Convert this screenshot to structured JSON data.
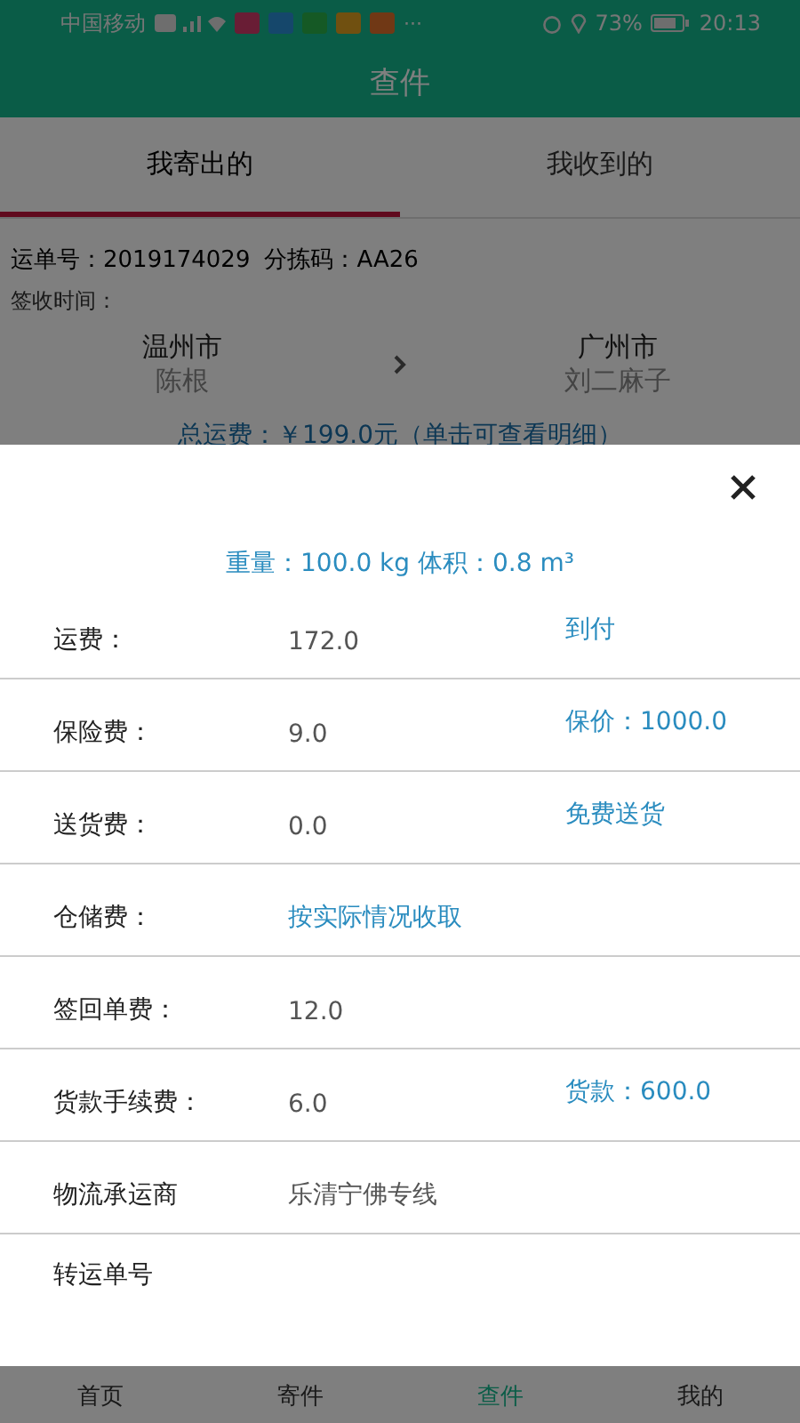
{
  "status_bar": {
    "carrier": "中国移动",
    "more": "···",
    "battery": "73%",
    "time": "20:13"
  },
  "title": "查件",
  "tabs": [
    {
      "label": "我寄出的",
      "selected": true
    },
    {
      "label": "我收到的",
      "selected": false
    }
  ],
  "shipment": {
    "waybill": "运单号：2019174029",
    "sort_code": "分拣码：AA26",
    "sign_time": "签收时间：",
    "from_city": "温州市",
    "from_name": "陈根",
    "to_city": "广州市",
    "to_name": "刘二麻子",
    "total": "总运费：￥199.0元（单击可查看明细）"
  },
  "fee_sheet": {
    "summary": "重量：100.0 kg 体积：0.8 m³",
    "rows": [
      {
        "label": "运费：",
        "value": "172.0",
        "kind": "plain",
        "extra": "到付"
      },
      {
        "label": "保险费：",
        "value": "9.0",
        "kind": "plain",
        "extra": "保价：1000.0"
      },
      {
        "label": "送货费：",
        "value": "0.0",
        "kind": "plain",
        "extra": "免费送货"
      },
      {
        "label": "仓储费：",
        "value": "按实际情况收取",
        "kind": "note"
      },
      {
        "label": "签回单费：",
        "value": "12.0",
        "kind": "plain"
      },
      {
        "label": "货款手续费：",
        "value": "6.0",
        "kind": "plain",
        "extra": "货款：600.0"
      },
      {
        "label": "物流承运商",
        "value": "乐清宁佛专线",
        "kind": "plain"
      },
      {
        "label": "转运单号",
        "kind": "plain"
      }
    ]
  },
  "bottom_nav": [
    {
      "label": "首页",
      "selected": false
    },
    {
      "label": "寄件",
      "selected": false
    },
    {
      "label": "查件",
      "selected": true
    },
    {
      "label": "我的",
      "selected": false
    }
  ]
}
